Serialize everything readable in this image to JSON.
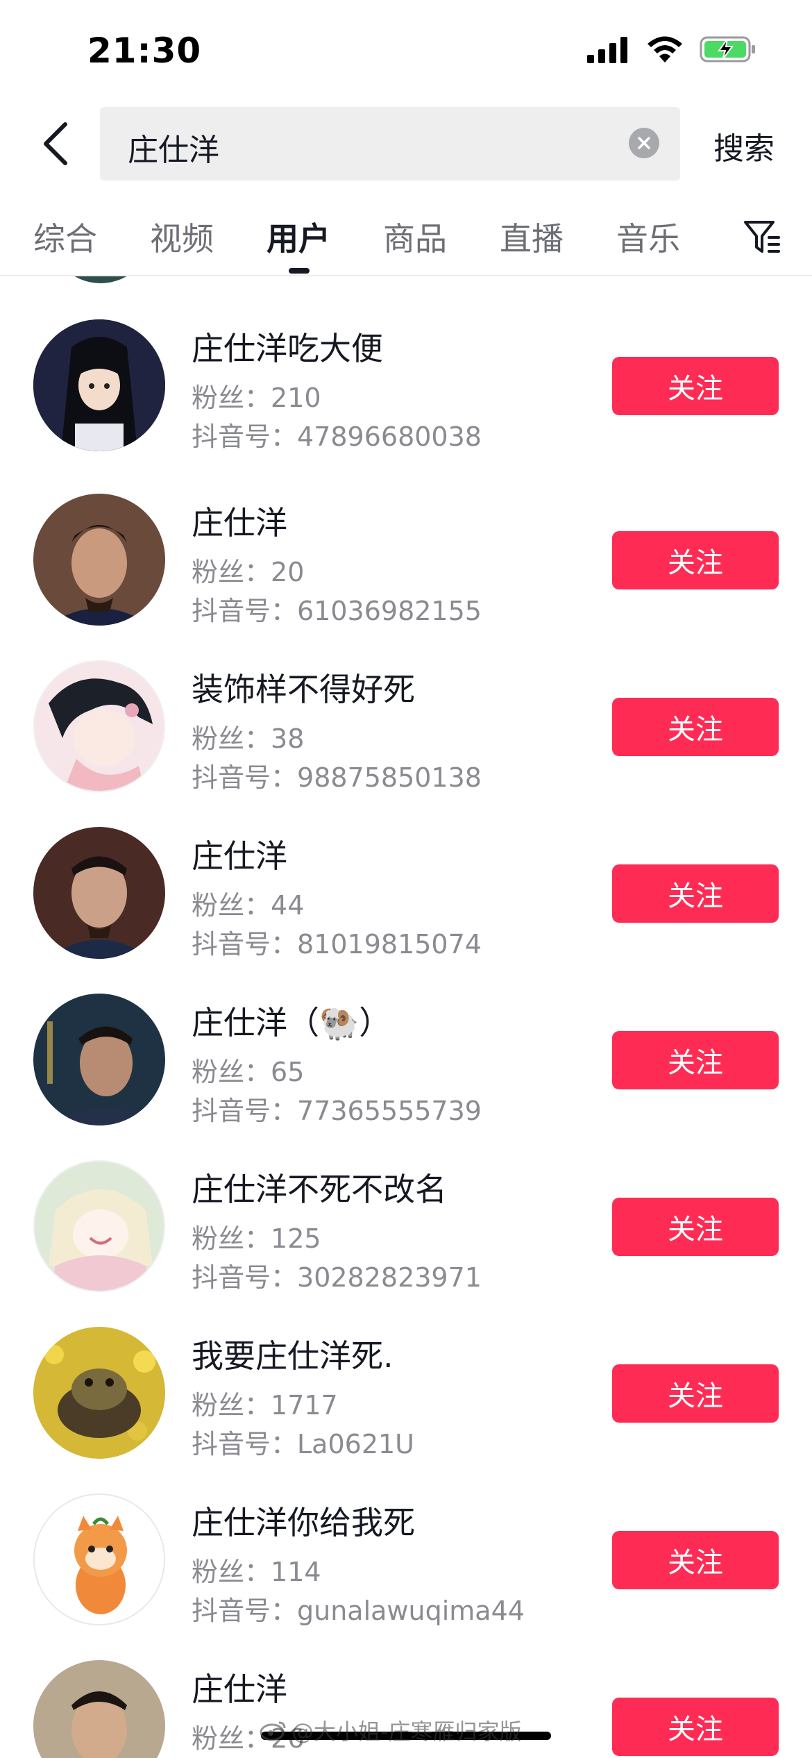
{
  "status_bar": {
    "time": "21:30"
  },
  "search": {
    "query": "庄仕洋",
    "action_label": "搜索"
  },
  "tabs": [
    {
      "label": "综合"
    },
    {
      "label": "视频"
    },
    {
      "label": "用户",
      "active": true
    },
    {
      "label": "商品"
    },
    {
      "label": "直播"
    },
    {
      "label": "音乐"
    }
  ],
  "users": [
    {
      "name": "庄仕洋吃大便",
      "fans_label": "粉丝：",
      "fans": "210",
      "id_label": "抖音号：",
      "id": "47896680038",
      "follow_label": "关注"
    },
    {
      "name": "庄仕洋",
      "fans_label": "粉丝：",
      "fans": "20",
      "id_label": "抖音号：",
      "id": "61036982155",
      "follow_label": "关注"
    },
    {
      "name": "装饰样不得好死",
      "fans_label": "粉丝：",
      "fans": "38",
      "id_label": "抖音号：",
      "id": "98875850138",
      "follow_label": "关注"
    },
    {
      "name": "庄仕洋",
      "fans_label": "粉丝：",
      "fans": "44",
      "id_label": "抖音号：",
      "id": "81019815074",
      "follow_label": "关注"
    },
    {
      "name": "庄仕洋（🐏）",
      "fans_label": "粉丝：",
      "fans": "65",
      "id_label": "抖音号：",
      "id": "77365555739",
      "follow_label": "关注"
    },
    {
      "name": "庄仕洋不死不改名",
      "fans_label": "粉丝：",
      "fans": "125",
      "id_label": "抖音号：",
      "id": "30282823971",
      "follow_label": "关注"
    },
    {
      "name": "我要庄仕洋死.",
      "fans_label": "粉丝：",
      "fans": "1717",
      "id_label": "抖音号：",
      "id": "La0621U",
      "follow_label": "关注"
    },
    {
      "name": "庄仕洋你给我死",
      "fans_label": "粉丝：",
      "fans": "114",
      "id_label": "抖音号：",
      "id": "gunalawuqima44",
      "follow_label": "关注"
    },
    {
      "name": "庄仕洋",
      "fans_label": "粉丝：",
      "fans": "26",
      "follow_label": "关注"
    }
  ],
  "watermark": {
    "text": "@大小姐-庄寒雁归家版"
  },
  "colors": {
    "accent": "#fe2c55",
    "text_primary": "#161823",
    "text_secondary": "#8a8b91",
    "search_bg": "#eeeeef",
    "battery_green": "#4cd964"
  },
  "icons": [
    "signal-icon",
    "wifi-icon",
    "battery-charging-icon",
    "back-arrow-icon",
    "clear-icon",
    "filter-icon",
    "weibo-icon"
  ]
}
